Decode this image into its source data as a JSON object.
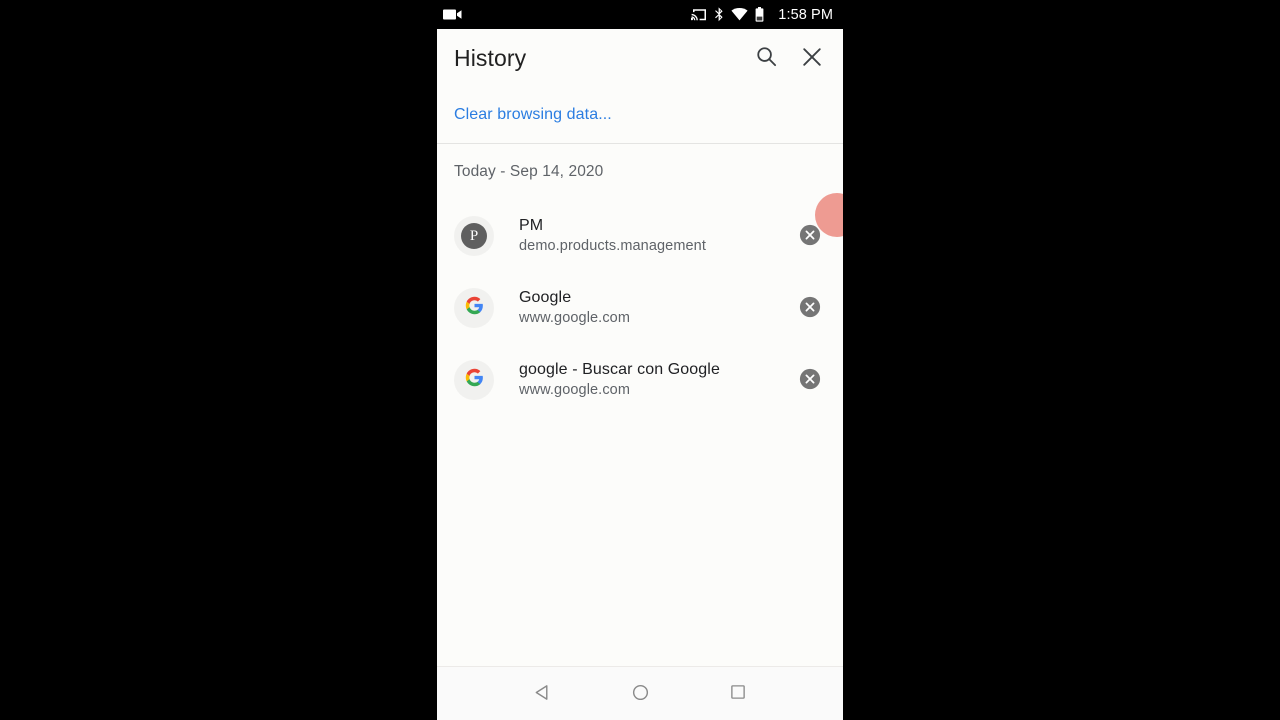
{
  "status_bar": {
    "recording_icon": "video-camera-icon",
    "cast_icon": "cast-icon",
    "bluetooth_icon": "bluetooth-icon",
    "wifi_icon": "wifi-icon",
    "battery_icon": "battery-icon",
    "time": "1:58 PM",
    "background_color": "#000000",
    "foreground_color": "#ffffff"
  },
  "app": {
    "title": "History",
    "search_icon": "search-icon",
    "close_icon": "close-icon",
    "clear_browsing_data_label": "Clear browsing data...",
    "link_color": "#2b7de1",
    "date_header": "Today - Sep 14, 2020",
    "remove_icon": "remove-circle-icon",
    "items": [
      {
        "title": "PM",
        "url": "demo.products.management",
        "favicon": "pm-letter-icon",
        "favicon_letter": "P",
        "favicon_color": "#5f5f5f"
      },
      {
        "title": "Google",
        "url": "www.google.com",
        "favicon": "google-g-icon"
      },
      {
        "title": "google - Buscar con Google",
        "url": "www.google.com",
        "favicon": "google-g-icon"
      }
    ],
    "edge_blob_color": "#ee9b92"
  },
  "navigation_bar": {
    "back_icon": "back-triangle-icon",
    "home_icon": "home-circle-icon",
    "recents_icon": "recents-square-icon"
  }
}
